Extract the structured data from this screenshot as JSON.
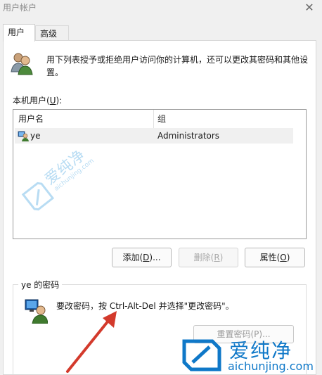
{
  "window": {
    "title": "用户帐户",
    "close_glyph": "✕"
  },
  "tabs": [
    {
      "label": "用户"
    },
    {
      "label": "高级"
    }
  ],
  "description": "用下列表授予或拒绝用户访问你的计算机，还可以更改其密码和其他设置。",
  "user_list": {
    "label_prefix": "本机用户(",
    "label_key": "U",
    "label_suffix": "):",
    "columns": [
      {
        "label": "用户名"
      },
      {
        "label": "组"
      }
    ],
    "rows": [
      {
        "name": "ye",
        "group": "Administrators"
      }
    ]
  },
  "buttons": {
    "add": {
      "prefix": "添加(",
      "key": "D",
      "suffix": ")..."
    },
    "delete": {
      "prefix": "删除(",
      "key": "R",
      "suffix": ")"
    },
    "properties": {
      "prefix": "属性(",
      "key": "O",
      "suffix": ")"
    }
  },
  "password_section": {
    "title": "ye 的密码",
    "text": "要改密码，按 Ctrl-Alt-Del 并选择\"更改密码\"。",
    "reset_button": "重置密码(P)..."
  },
  "watermark": {
    "center_cn": "爱纯净",
    "center_en": "aichunjing.com",
    "brand_cn": "爱纯净",
    "brand_en": "aichunjing.com"
  },
  "colors": {
    "annotation_arrow": "#d33a2c",
    "brand": "#0f78c8"
  }
}
